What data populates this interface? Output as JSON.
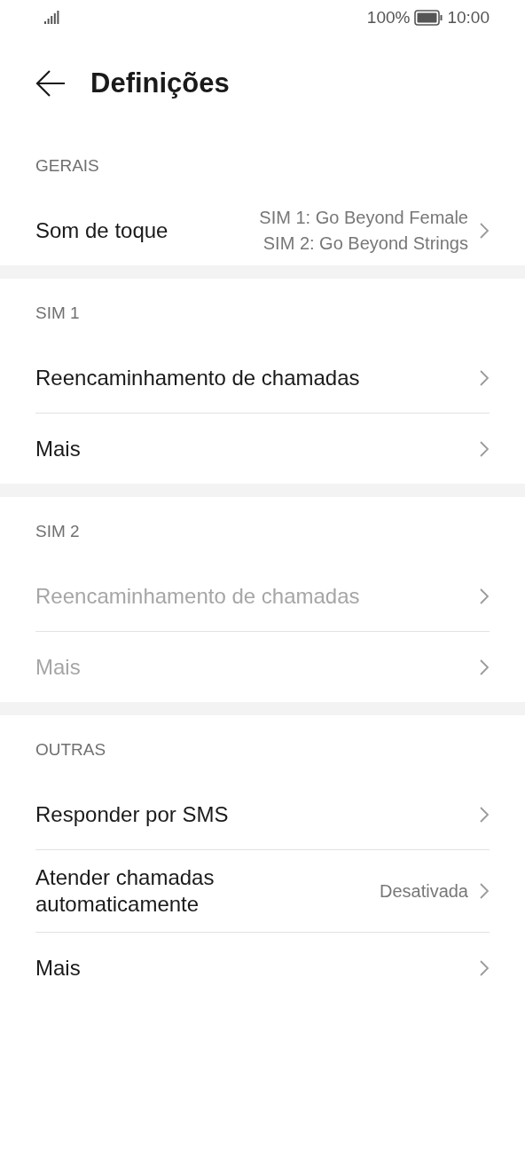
{
  "status_bar": {
    "battery_text": "100%",
    "time": "10:00"
  },
  "header": {
    "title": "Definições"
  },
  "sections": [
    {
      "title": "GERAIS",
      "items": [
        {
          "label": "Som de toque",
          "values": [
            "SIM 1: Go Beyond Female",
            "SIM 2: Go Beyond Strings"
          ],
          "disabled": false
        }
      ]
    },
    {
      "title": "SIM 1",
      "items": [
        {
          "label": "Reencaminhamento de chamadas",
          "disabled": false
        },
        {
          "label": "Mais",
          "disabled": false
        }
      ]
    },
    {
      "title": "SIM 2",
      "items": [
        {
          "label": "Reencaminhamento de chamadas",
          "disabled": true
        },
        {
          "label": "Mais",
          "disabled": true
        }
      ]
    },
    {
      "title": "OUTRAS",
      "items": [
        {
          "label": "Responder por SMS",
          "disabled": false
        },
        {
          "label": "Atender chamadas automaticamente",
          "values": [
            "Desativada"
          ],
          "disabled": false
        },
        {
          "label": "Mais",
          "disabled": false
        }
      ]
    }
  ]
}
